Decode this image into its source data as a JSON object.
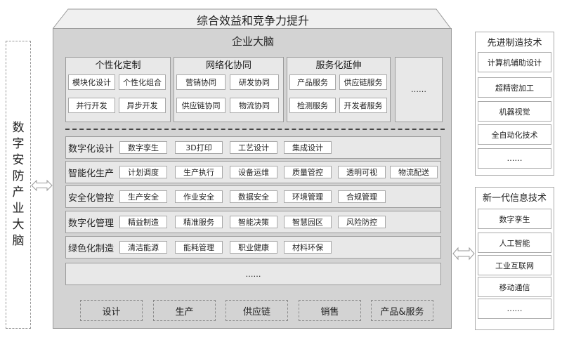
{
  "left_label": "数字安防产业大脑",
  "top_title": "综合效益和竞争力提升",
  "main_title": "企业大脑",
  "top_groups": [
    {
      "title": "个性化定制",
      "items": [
        "模块化设计",
        "个性化组合",
        "并行开发",
        "异步开发"
      ]
    },
    {
      "title": "网络化协同",
      "items": [
        "营销协同",
        "研发协同",
        "供应链协同",
        "物流协同"
      ]
    },
    {
      "title": "服务化延伸",
      "items": [
        "产品服务",
        "供应链服务",
        "检测服务",
        "开发者服务"
      ]
    }
  ],
  "top_more": "……",
  "rows": [
    {
      "label": "数字化设计",
      "items": [
        "数字孪生",
        "3D打印",
        "工艺设计",
        "集成设计"
      ]
    },
    {
      "label": "智能化生产",
      "items": [
        "计划调度",
        "生产执行",
        "设备运维",
        "质量管控",
        "透明可视",
        "物流配送"
      ]
    },
    {
      "label": "安全化管控",
      "items": [
        "生产安全",
        "作业安全",
        "数据安全",
        "环境管理",
        "合规管理"
      ]
    },
    {
      "label": "数字化管理",
      "items": [
        "精益制造",
        "精准服务",
        "智能决策",
        "智慧园区",
        "风险防控"
      ]
    },
    {
      "label": "绿色化制造",
      "items": [
        "清洁能源",
        "能耗管理",
        "职业健康",
        "材料环保"
      ]
    }
  ],
  "rows_more": "……",
  "functions": [
    "设计",
    "生产",
    "供应链",
    "销售",
    "产品&服务"
  ],
  "right_top": {
    "title": "先进制造技术",
    "items": [
      "计算机辅助设计",
      "超精密加工",
      "机器视觉",
      "全自动化技术",
      "……"
    ]
  },
  "right_bottom": {
    "title": "新一代信息技术",
    "items": [
      "数字孪生",
      "人工智能",
      "工业互联网",
      "移动通信",
      "……"
    ]
  }
}
